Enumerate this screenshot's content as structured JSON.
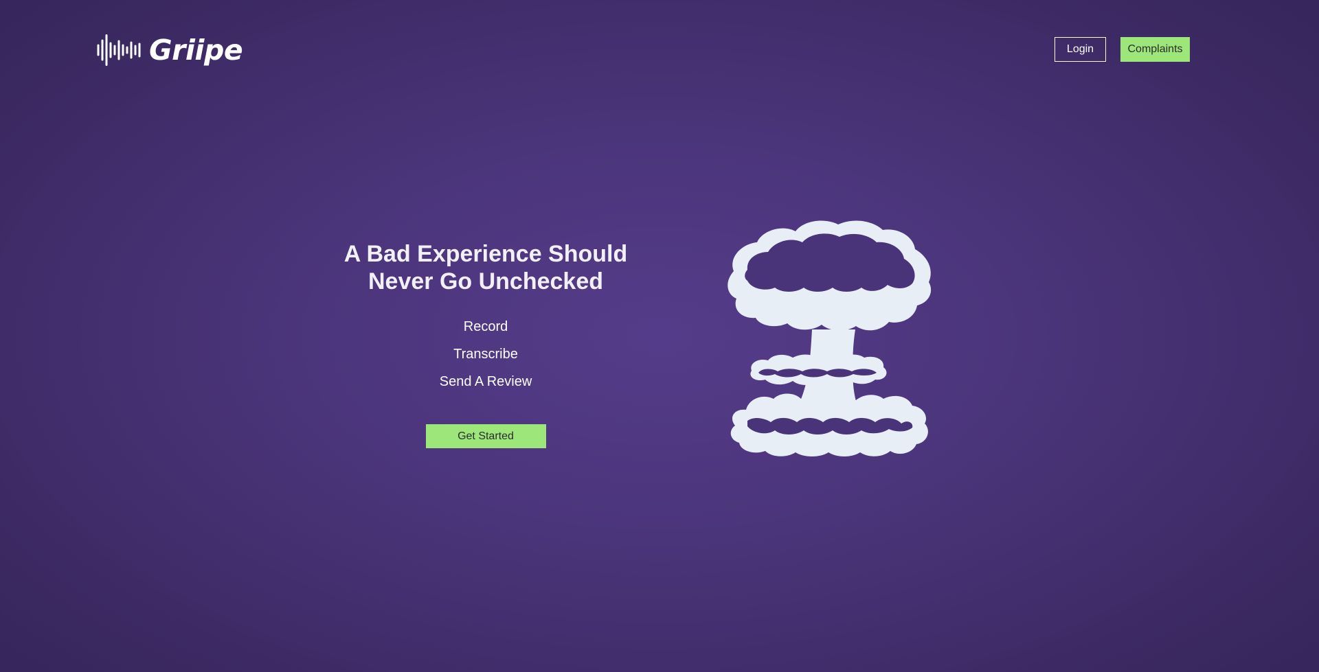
{
  "brand": {
    "name": "Griipe",
    "icon": "soundwave-icon"
  },
  "nav": {
    "login_label": "Login",
    "complaints_label": "Complaints"
  },
  "hero": {
    "title_line1": "A Bad Experience Should",
    "title_line2": "Never Go Unchecked",
    "features": [
      "Record",
      "Transcribe",
      "Send A Review"
    ],
    "cta_label": "Get Started",
    "illustration": "mushroom-cloud-icon"
  },
  "colors": {
    "background": "#4a3479",
    "accent": "#9de67a",
    "text": "#ffffff",
    "illustration": "#e8eef6"
  }
}
